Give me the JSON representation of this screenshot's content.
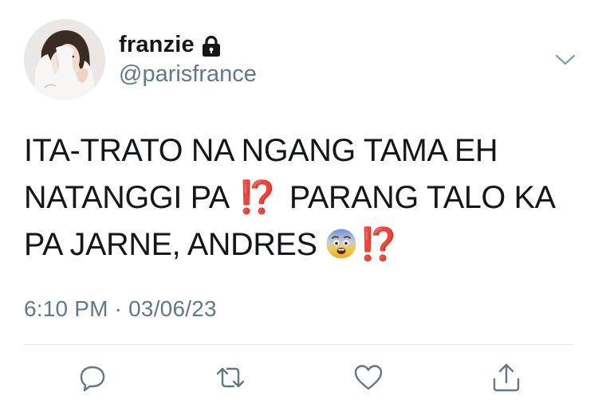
{
  "user": {
    "display_name": "franzie",
    "handle": "@parisfrance",
    "protected_icon": "lock-icon",
    "avatar_icon": "profile-photo"
  },
  "tweet": {
    "lines": [
      "ITA-TRATO NA NGANG TAMA EH",
      "NATANGGI PA",
      "PARANG TALO KA",
      "PA JARNE, ANDRES"
    ],
    "emoji_exclamation_question": "⁉️",
    "emoji_fearful_face": "😨"
  },
  "timestamp": "6:10 PM · 03/06/23",
  "actions": [
    {
      "icon": "reply-icon"
    },
    {
      "icon": "retweet-icon"
    },
    {
      "icon": "like-icon"
    },
    {
      "icon": "share-icon"
    }
  ],
  "colors": {
    "text": "#14171a",
    "secondary": "#657786",
    "icon": "#657786",
    "divider": "#e1e8ed",
    "exclamation": "#e0342e"
  }
}
